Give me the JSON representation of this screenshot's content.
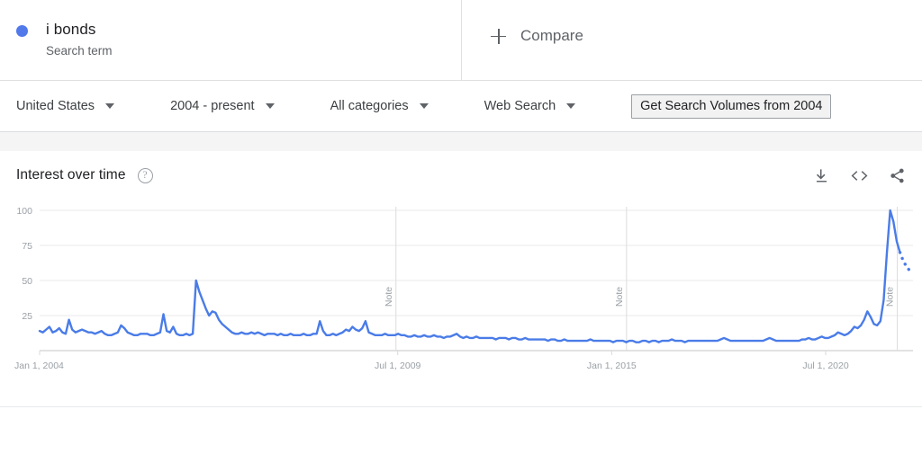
{
  "term": {
    "name": "i bonds",
    "subtitle": "Search term",
    "color": "#5179ea"
  },
  "compare": {
    "label": "Compare",
    "icon": "plus-icon"
  },
  "filters": [
    {
      "label": "United States",
      "icon": "chevron-down-icon"
    },
    {
      "label": "2004 - present",
      "icon": "chevron-down-icon"
    },
    {
      "label": "All categories",
      "icon": "chevron-down-icon"
    },
    {
      "label": "Web Search",
      "icon": "chevron-down-icon"
    }
  ],
  "volumes_button": {
    "label": "Get Search Volumes from 2004"
  },
  "card": {
    "title": "Interest over time",
    "help_icon": "help-circle-icon",
    "actions": [
      {
        "name": "download-icon",
        "title": "Download"
      },
      {
        "name": "embed-code-icon",
        "title": "Embed"
      },
      {
        "name": "share-icon",
        "title": "Share"
      }
    ]
  },
  "chart_data": {
    "type": "line",
    "title": "Interest over time",
    "xlabel": "",
    "ylabel": "",
    "ylim": [
      0,
      100
    ],
    "yticks": [
      25,
      50,
      75,
      100
    ],
    "ytick_labels": [
      "25",
      "50",
      "75",
      "100"
    ],
    "grid": true,
    "legend": false,
    "series_color": "#4a7ce8",
    "x_tick_labels": [
      "Jan 1, 2004",
      "Jul 1, 2009",
      "Jan 1, 2015",
      "Jul 1, 2020"
    ],
    "x_tick_positions": [
      0,
      0.41,
      0.655,
      0.9
    ],
    "annotations": [
      {
        "label": "Note",
        "x": 0.408
      },
      {
        "label": "Note",
        "x": 0.672
      },
      {
        "label": "Note",
        "x": 0.982
      }
    ],
    "partial_data_note": "final dotted segment indicates incomplete period",
    "series": [
      {
        "name": "i bonds",
        "values": [
          14,
          13,
          15,
          17,
          13,
          14,
          16,
          13,
          12,
          22,
          15,
          13,
          14,
          15,
          14,
          13,
          13,
          12,
          13,
          14,
          12,
          11,
          11,
          12,
          13,
          18,
          16,
          13,
          12,
          11,
          11,
          12,
          12,
          12,
          11,
          11,
          12,
          13,
          26,
          14,
          13,
          17,
          12,
          11,
          11,
          12,
          11,
          12,
          50,
          42,
          36,
          30,
          25,
          28,
          27,
          22,
          19,
          17,
          15,
          13,
          12,
          12,
          13,
          12,
          12,
          13,
          12,
          13,
          12,
          11,
          12,
          12,
          12,
          11,
          12,
          11,
          11,
          12,
          11,
          11,
          11,
          12,
          11,
          11,
          12,
          12,
          21,
          14,
          11,
          11,
          12,
          11,
          12,
          13,
          15,
          14,
          17,
          15,
          14,
          16,
          21,
          13,
          12,
          11,
          11,
          11,
          12,
          11,
          11,
          11,
          12,
          11,
          11,
          10,
          10,
          11,
          10,
          10,
          11,
          10,
          10,
          11,
          10,
          10,
          9,
          10,
          10,
          11,
          12,
          10,
          9,
          10,
          9,
          9,
          10,
          9,
          9,
          9,
          9,
          9,
          8,
          9,
          9,
          9,
          8,
          9,
          9,
          8,
          8,
          9,
          8,
          8,
          8,
          8,
          8,
          8,
          7,
          8,
          8,
          7,
          7,
          8,
          7,
          7,
          7,
          7,
          7,
          7,
          7,
          8,
          7,
          7,
          7,
          7,
          7,
          7,
          6,
          7,
          7,
          7,
          6,
          7,
          7,
          6,
          6,
          7,
          7,
          6,
          7,
          7,
          6,
          7,
          7,
          7,
          8,
          7,
          7,
          7,
          6,
          7,
          7,
          7,
          7,
          7,
          7,
          7,
          7,
          7,
          7,
          8,
          9,
          8,
          7,
          7,
          7,
          7,
          7,
          7,
          7,
          7,
          7,
          7,
          7,
          8,
          9,
          8,
          7,
          7,
          7,
          7,
          7,
          7,
          7,
          7,
          8,
          8,
          9,
          8,
          8,
          9,
          10,
          9,
          9,
          10,
          11,
          13,
          12,
          11,
          12,
          14,
          17,
          16,
          18,
          22,
          28,
          24,
          19,
          18,
          21,
          36,
          70,
          100,
          92,
          78,
          70,
          64,
          60,
          57,
          55
        ]
      }
    ]
  }
}
